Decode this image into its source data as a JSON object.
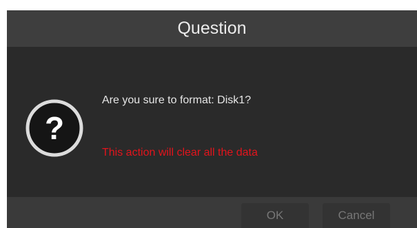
{
  "dialog": {
    "title": "Question",
    "message": "Are you sure to format: Disk1?",
    "warning": "This action will clear all the data",
    "icon": "question-icon",
    "buttons": {
      "ok": "OK",
      "cancel": "Cancel"
    }
  },
  "colors": {
    "warning_text": "#e3141c",
    "dialog_background": "#2a2a2a",
    "title_bar": "#3e3e3e"
  }
}
